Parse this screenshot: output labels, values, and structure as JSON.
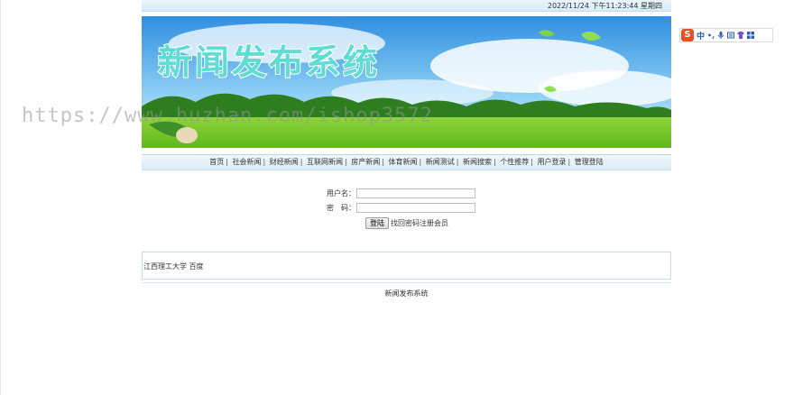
{
  "header": {
    "datetime": "2022/11/24 下午11:23:44  星期四"
  },
  "banner": {
    "title": "新闻发布系统"
  },
  "nav": {
    "items": [
      "首页",
      "社会新闻",
      "财经新闻",
      "互联网新闻",
      "房产新闻",
      "体育新闻",
      "新闻测试",
      "新闻搜索",
      "个性推荐",
      "用户登录",
      "管理登陆"
    ]
  },
  "login": {
    "username_label": "用户名：",
    "password_label": "密　码：",
    "username_value": "",
    "password_value": "",
    "submit_label": "登陆",
    "forgot_label": "找回密码",
    "register_label": "注册会员"
  },
  "friend_links": {
    "items": [
      "江西理工大学",
      "百度"
    ]
  },
  "footer": {
    "text": "新闻发布系统"
  },
  "watermark": {
    "text": "https://www.huzhan.com/ishop3572"
  },
  "ime": {
    "logo": "S",
    "mode": "中",
    "punct": "•,"
  },
  "colors": {
    "accent_green": "#3aa13a",
    "banner_title": "#5fdcd3",
    "ime_logo": "#e8501f"
  }
}
